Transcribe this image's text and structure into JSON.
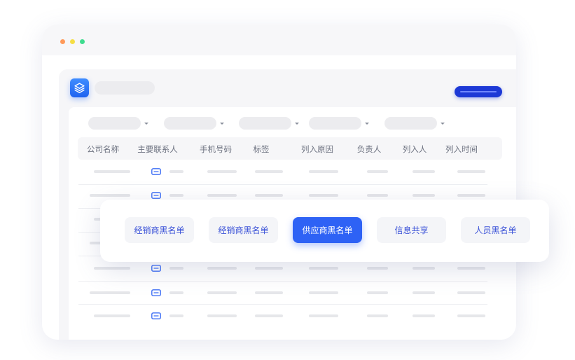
{
  "colors": {
    "accent": "#2e62f5",
    "primary_button": "#1d39d6",
    "tab_text": "#3d54d8",
    "placeholder": "#e6e7ea"
  },
  "window": {
    "controls": [
      "close",
      "minimize",
      "maximize"
    ]
  },
  "app": {
    "logo_icon": "layers-icon",
    "row_icon": "chat-icon"
  },
  "table": {
    "headers": [
      "公司名称",
      "主要联系人",
      "手机号码",
      "标签",
      "列入原因",
      "负责人",
      "列入人",
      "列入时间"
    ]
  },
  "categories": {
    "active_index": 2,
    "items": [
      {
        "label": "经销商黑名单"
      },
      {
        "label": "经销商黑名单"
      },
      {
        "label": "供应商黑名单"
      },
      {
        "label": "信息共享"
      },
      {
        "label": "人员黑名单"
      }
    ]
  }
}
